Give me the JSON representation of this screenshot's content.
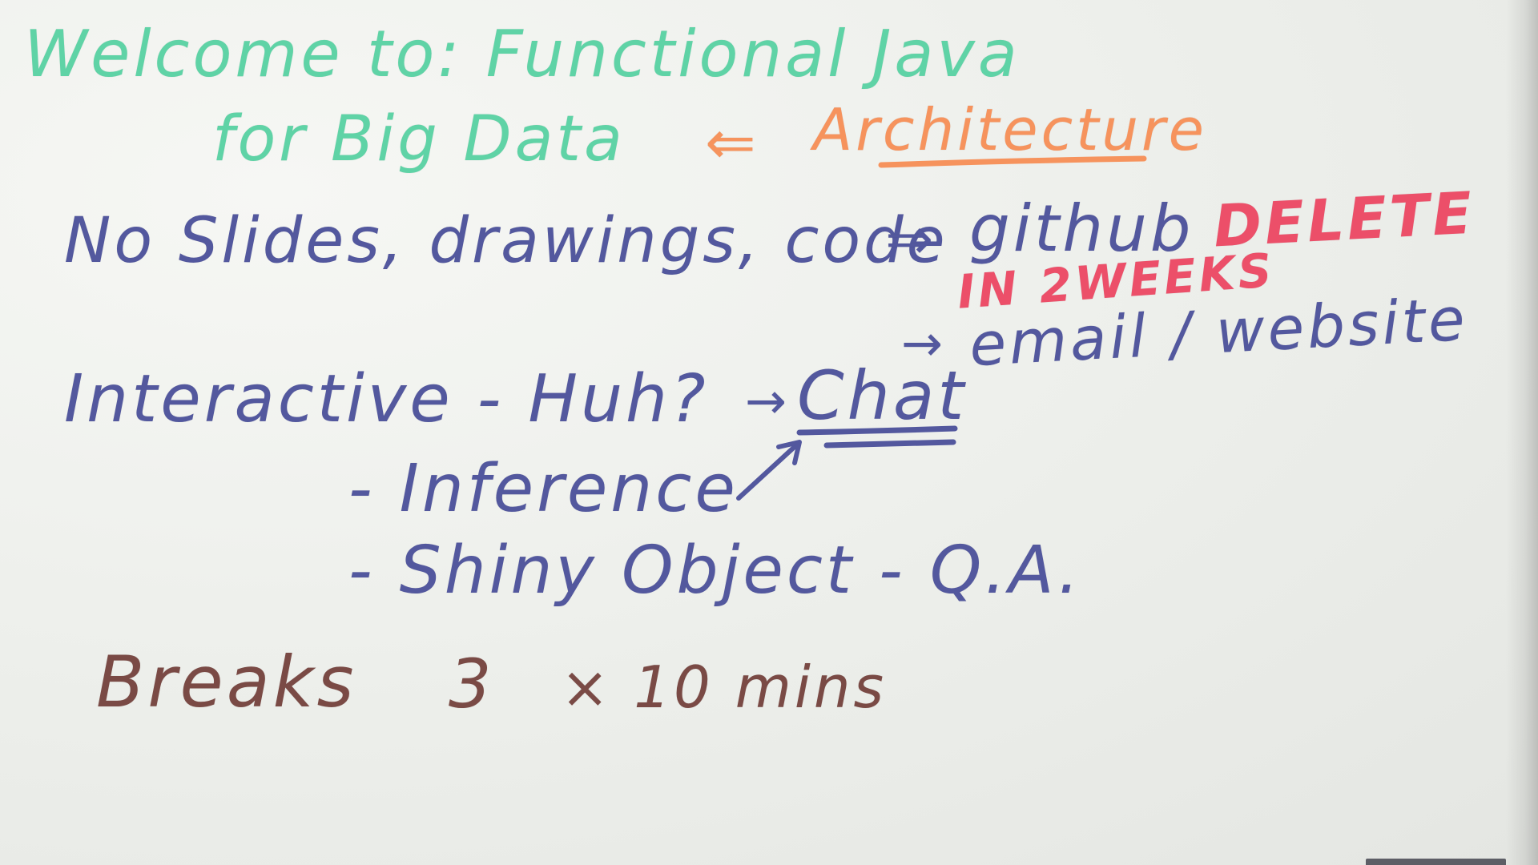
{
  "board": {
    "line1": "Welcome to: Functional Java",
    "line2": "for Big Data",
    "arrow_left": "⇐",
    "architecture": "Architecture",
    "no_slides": "No Slides, drawings, code",
    "double_arrow": "⇒",
    "github": "github",
    "delete": "DELETE",
    "in_2_weeks": "IN 2WEEKS",
    "arrow_email": "→",
    "email_website": "email / website",
    "interactive": "Interactive - Huh?",
    "arrow_chat": "→",
    "chat": "Chat",
    "inference": "- Inference",
    "shiny_object": "- Shiny Object - Q.A.",
    "breaks": "Breaks",
    "breaks_count": "3",
    "breaks_times": "× 10 mins"
  },
  "colors": {
    "green": "#5fd3a6",
    "orange": "#f6935d",
    "blue": "#53589e",
    "pink": "#ec4f69",
    "brown": "#7a4a45"
  }
}
